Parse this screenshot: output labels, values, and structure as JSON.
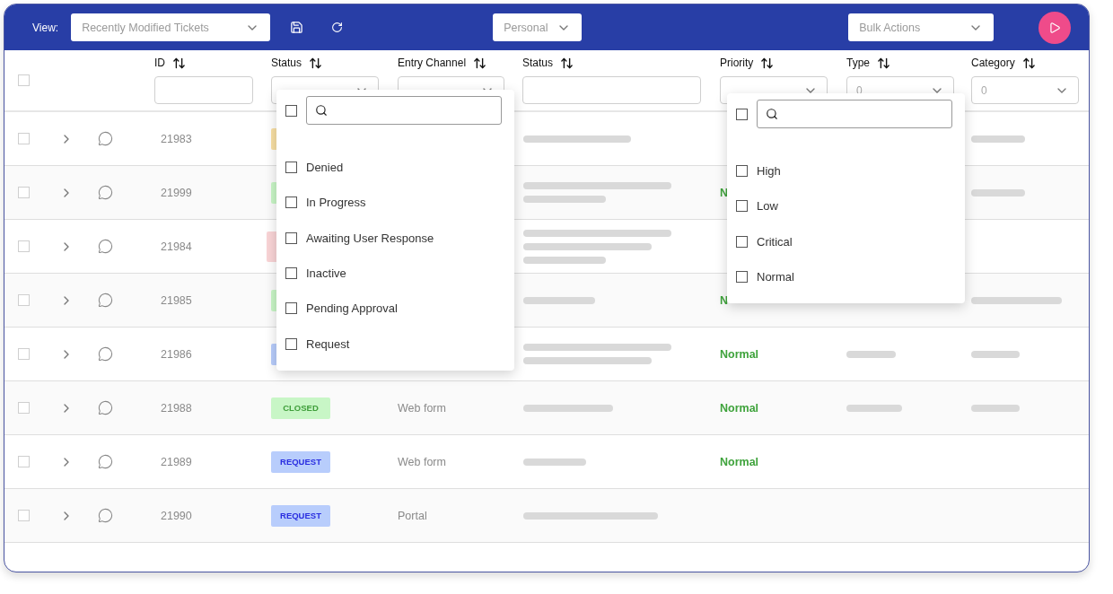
{
  "toolbar": {
    "view_label": "View:",
    "view_select": "Recently Modified Tickets",
    "scope_select": "Personal",
    "bulk_select": "Bulk Actions"
  },
  "table": {
    "select_all_checked": false,
    "columns": [
      {
        "label": "ID",
        "filter": {
          "kind": "text"
        }
      },
      {
        "label": "Status",
        "filter": {
          "kind": "select"
        }
      },
      {
        "label": "Entry Channel",
        "filter": {
          "kind": "select"
        }
      },
      {
        "label": "Status",
        "filter": {
          "kind": "text"
        }
      },
      {
        "label": "Priority",
        "filter": {
          "kind": "select"
        }
      },
      {
        "label": "Type",
        "filter": {
          "kind": "select",
          "value": "0"
        }
      },
      {
        "label": "Category",
        "filter": {
          "kind": "select",
          "value": "0"
        }
      }
    ],
    "rows": [
      {
        "checked": false,
        "id": "21983",
        "status": {
          "color": "#f8dfa4"
        }
      },
      {
        "checked": false,
        "id": "21999",
        "status": {
          "color": "#c8f6c6"
        },
        "priority": "N"
      },
      {
        "checked": false,
        "id": "21984",
        "status": {
          "color": "#f9d4d6"
        }
      },
      {
        "checked": false,
        "id": "21985",
        "status": {
          "color": "#c8f6c6"
        },
        "priority": "N"
      },
      {
        "checked": false,
        "id": "21986",
        "status": {
          "color": "#b8cdfc"
        },
        "priority": "Normal"
      },
      {
        "checked": false,
        "id": "21988",
        "status": {
          "color": "#c8f6c6",
          "label": "CLOSED"
        },
        "channel": "Web form",
        "priority": "Normal"
      },
      {
        "checked": false,
        "id": "21989",
        "status": {
          "color": "#b8cdfc",
          "label": "REQUEST"
        },
        "channel": "Web form",
        "priority": "Normal"
      },
      {
        "checked": false,
        "id": "21990",
        "status": {
          "color": "#b8cdfc",
          "label": "REQUEST"
        },
        "channel": "Portal"
      }
    ]
  },
  "status_filter_menu": {
    "select_all_checked": false,
    "options": [
      {
        "label": "Denied",
        "checked": false
      },
      {
        "label": "In Progress",
        "checked": false
      },
      {
        "label": "Awaiting User Response",
        "checked": false
      },
      {
        "label": "Inactive",
        "checked": false
      },
      {
        "label": "Pending Approval",
        "checked": false
      },
      {
        "label": "Request",
        "checked": false
      }
    ]
  },
  "priority_filter_menu": {
    "select_all_checked": false,
    "options": [
      {
        "label": "High",
        "checked": false
      },
      {
        "label": "Low",
        "checked": false
      },
      {
        "label": "Critical",
        "checked": false
      },
      {
        "label": "Normal",
        "checked": false
      }
    ]
  }
}
